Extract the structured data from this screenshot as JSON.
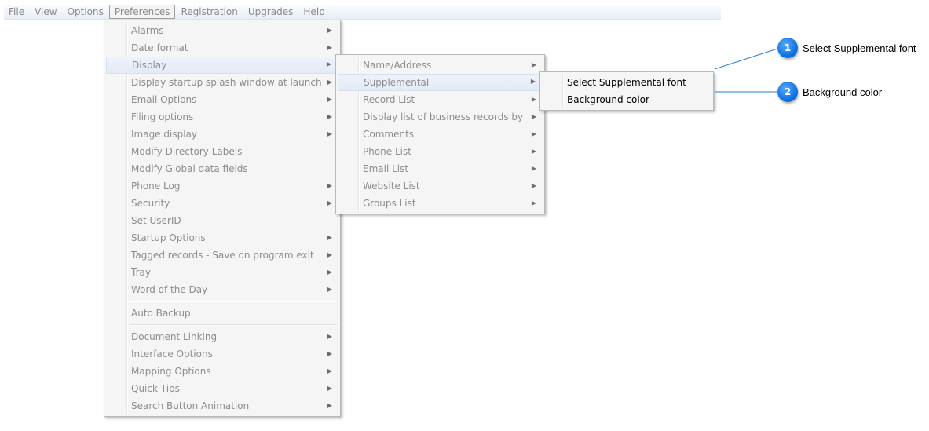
{
  "menubar": {
    "items": [
      {
        "label": "File"
      },
      {
        "label": "View"
      },
      {
        "label": "Options"
      },
      {
        "label": "Preferences"
      },
      {
        "label": "Registration"
      },
      {
        "label": "Upgrades"
      },
      {
        "label": "Help"
      }
    ],
    "open_item": "Preferences"
  },
  "preferences_menu": {
    "items": [
      {
        "label": "Alarms",
        "submenu": true
      },
      {
        "label": "Date format",
        "submenu": true
      },
      {
        "label": "Display",
        "submenu": true,
        "highlighted": true
      },
      {
        "label": "Display startup splash window at launch",
        "submenu": true
      },
      {
        "label": "Email Options",
        "submenu": true
      },
      {
        "label": "Filing options",
        "submenu": true
      },
      {
        "label": "Image display",
        "submenu": true
      },
      {
        "label": "Modify Directory Labels",
        "submenu": false
      },
      {
        "label": "Modify Global data fields",
        "submenu": false
      },
      {
        "label": "Phone Log",
        "submenu": true
      },
      {
        "label": "Security",
        "submenu": true
      },
      {
        "label": "Set UserID",
        "submenu": false
      },
      {
        "label": "Startup Options",
        "submenu": true
      },
      {
        "label": "Tagged records - Save on program exit",
        "submenu": true
      },
      {
        "label": "Tray",
        "submenu": true
      },
      {
        "label": "Word of the Day",
        "submenu": true
      },
      {
        "separator": true
      },
      {
        "label": "Auto Backup",
        "submenu": false
      },
      {
        "separator": true
      },
      {
        "label": "Document Linking",
        "submenu": true
      },
      {
        "label": "Interface Options",
        "submenu": true
      },
      {
        "label": "Mapping Options",
        "submenu": true
      },
      {
        "label": "Quick Tips",
        "submenu": true
      },
      {
        "label": "Search Button Animation",
        "submenu": true
      }
    ]
  },
  "display_menu": {
    "items": [
      {
        "label": "Name/Address",
        "submenu": true
      },
      {
        "label": "Supplemental",
        "submenu": true,
        "highlighted": true
      },
      {
        "label": "Record List",
        "submenu": true
      },
      {
        "label": "Display list of business records by",
        "submenu": true
      },
      {
        "label": "Comments",
        "submenu": true
      },
      {
        "label": "Phone List",
        "submenu": true
      },
      {
        "label": "Email List",
        "submenu": true
      },
      {
        "label": "Website List",
        "submenu": true
      },
      {
        "label": "Groups List",
        "submenu": true
      }
    ]
  },
  "supplemental_menu": {
    "items": [
      {
        "label": "Select Supplemental font",
        "submenu": false
      },
      {
        "label": "Background color",
        "submenu": false
      }
    ]
  },
  "callouts": [
    {
      "number": "1",
      "text": "Select Supplemental font"
    },
    {
      "number": "2",
      "text": "Background color"
    }
  ],
  "colors": {
    "badge": "#0a6fe0",
    "callout_line": "#2a7fd4",
    "menu_highlight": "#e3ebf6",
    "disabled_text": "#8d8d8d"
  },
  "icons": {
    "submenu_arrow": "submenu-arrow-icon"
  }
}
